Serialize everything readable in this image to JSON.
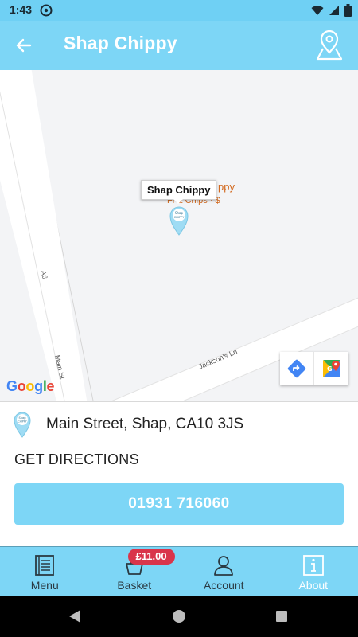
{
  "status_bar": {
    "time": "1:43"
  },
  "app_bar": {
    "title": "Shap Chippy"
  },
  "map": {
    "road_labels": {
      "a6": "A6",
      "main_st": "Main St",
      "jacksons_ln": "Jackson's Ln"
    },
    "poi": {
      "name_partial": "ppy",
      "sub_partial": "Fi  & Chips · $"
    },
    "info_window": "Shap Chippy",
    "marker_text": "Shap CHIPPY",
    "attribution": "Google"
  },
  "details": {
    "address": "Main Street, Shap, CA10 3JS",
    "directions_label": "GET DIRECTIONS",
    "phone": "01931 716060"
  },
  "bottom_nav": {
    "items": [
      {
        "label": "Menu",
        "icon": "menu-book-icon"
      },
      {
        "label": "Basket",
        "icon": "basket-icon",
        "badge": "£11.00"
      },
      {
        "label": "Account",
        "icon": "account-icon"
      },
      {
        "label": "About",
        "icon": "info-icon",
        "active": true
      }
    ]
  },
  "colors": {
    "primary": "#7dd6f6",
    "badge": "#d9354b",
    "poi": "#d2691e"
  }
}
